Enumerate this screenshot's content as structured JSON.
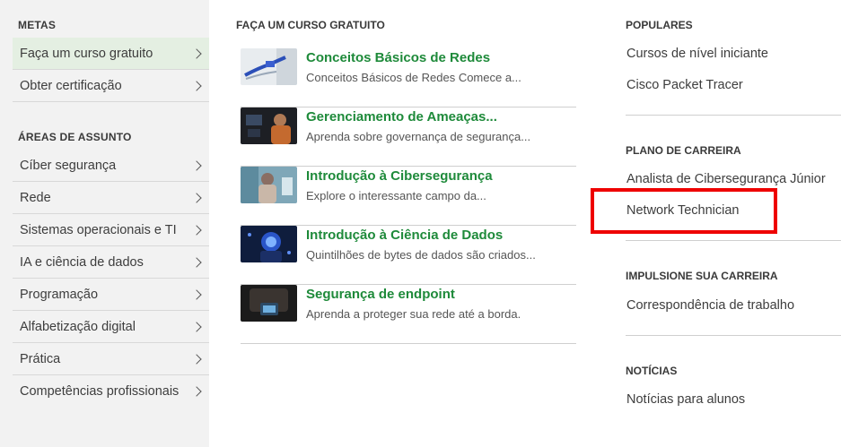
{
  "sidebar": {
    "metas_heading": "METAS",
    "metas_items": [
      {
        "label": "Faça um curso gratuito"
      },
      {
        "label": "Obter certificação"
      }
    ],
    "areas_heading": "ÁREAS DE ASSUNTO",
    "areas_items": [
      {
        "label": "Cíber segurança"
      },
      {
        "label": "Rede"
      },
      {
        "label": "Sistemas operacionais e TI"
      },
      {
        "label": "IA e ciência de dados"
      },
      {
        "label": "Programação"
      },
      {
        "label": "Alfabetização digital"
      },
      {
        "label": "Prática"
      },
      {
        "label": "Competências profissionais"
      }
    ]
  },
  "middle": {
    "heading": "FAÇA UM CURSO GRATUITO",
    "courses": [
      {
        "title": "Conceitos Básicos de Redes",
        "desc": "Conceitos Básicos de Redes Comece a..."
      },
      {
        "title": "Gerenciamento de Ameaças...",
        "desc": "Aprenda sobre governança de segurança..."
      },
      {
        "title": "Introdução à Cibersegurança",
        "desc": "Explore o interessante campo da..."
      },
      {
        "title": "Introdução à Ciência de Dados",
        "desc": "Quintilhões de bytes de dados são criados..."
      },
      {
        "title": "Segurança de endpoint",
        "desc": "Aprenda a proteger sua rede até a borda."
      }
    ]
  },
  "right": {
    "populares_heading": "POPULARES",
    "populares_links": [
      "Cursos de nível iniciante",
      "Cisco Packet Tracer"
    ],
    "plano_heading": "PLANO DE CARREIRA",
    "plano_links": [
      "Analista de Cibersegurança Júnior",
      "Network Technician"
    ],
    "impulsione_heading": "IMPULSIONE SUA CARREIRA",
    "impulsione_links": [
      "Correspondência de trabalho"
    ],
    "noticias_heading": "NOTÍCIAS",
    "noticias_links": [
      "Notícias para alunos"
    ]
  },
  "colors": {
    "accent_green": "#1e8a3a",
    "highlight_red": "#ee0000",
    "active_bg": "#e4efe2"
  }
}
